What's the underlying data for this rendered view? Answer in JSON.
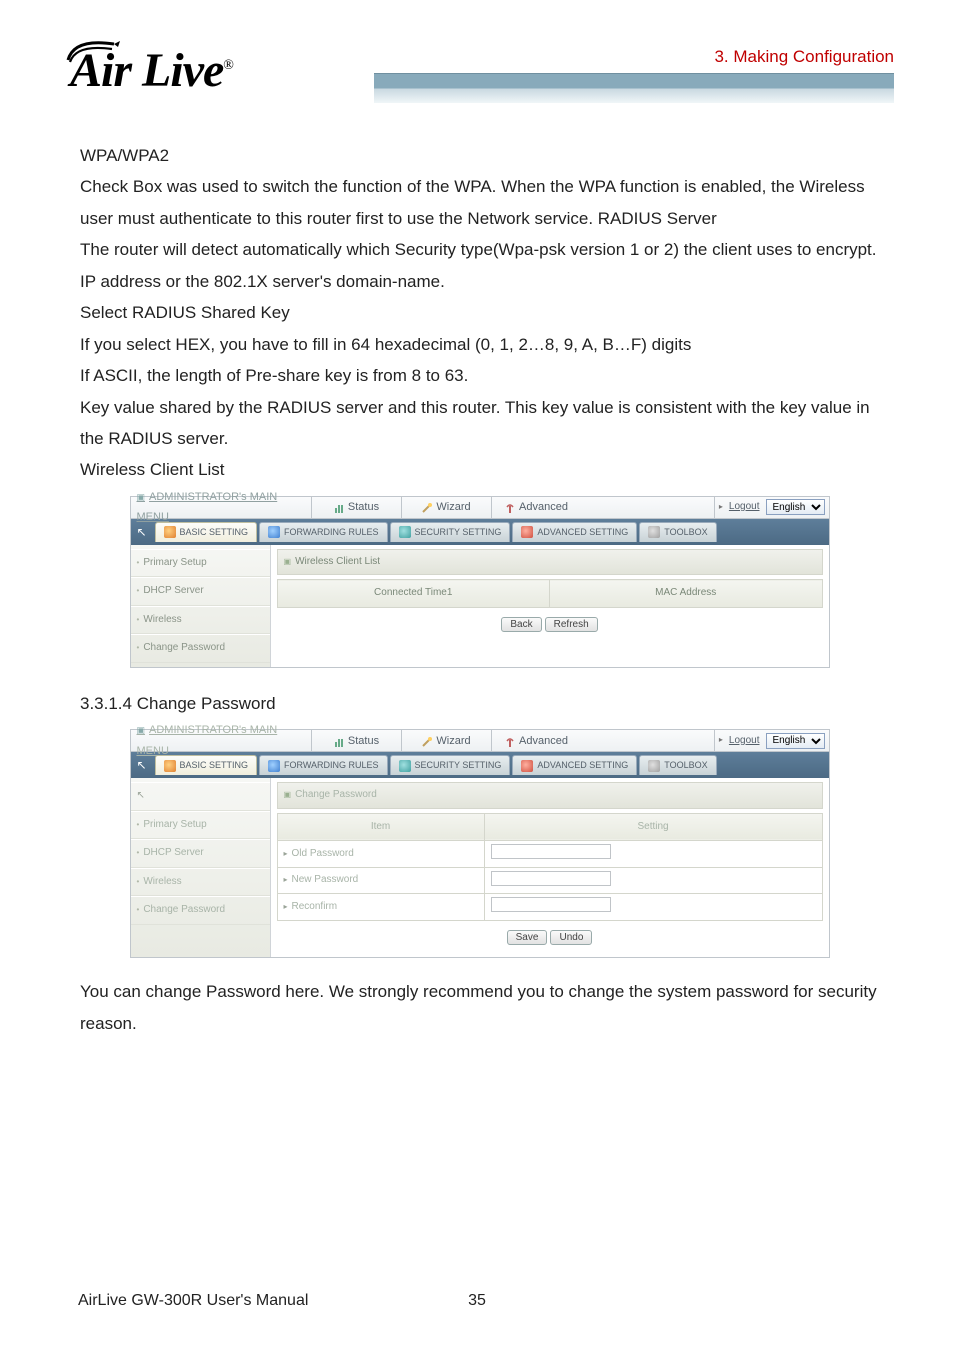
{
  "header": {
    "chapter": "3.  Making  Configuration",
    "logo_main": "Air Live",
    "logo_reg": "®"
  },
  "body": {
    "h1": "WPA/WPA2",
    "p1": "Check Box was used to switch the function of the WPA. When the WPA function is enabled, the Wireless user must authenticate to this router first to use the Network service. RADIUS Server",
    "p2": "The router will detect automatically    which Security type(Wpa-psk version 1 or 2) the client uses to encrypt.",
    "p3": "IP address or the 802.1X server's domain-name.",
    "p4": "Select RADIUS Shared Key",
    "p5": "If you select HEX, you have to fill in 64 hexadecimal (0, 1, 2…8, 9, A, B…F) digits",
    "p6": "If ASCII, the length of Pre-share key is from 8 to 63.",
    "p7": "Key value shared by the RADIUS server and this router. This key value is consistent with the key value in the RADIUS server.",
    "p8": "Wireless Client List",
    "sec314": "3.3.1.4 Change Password",
    "closing": "You can change Password here. We strongly recommend you to change the system password for security reason."
  },
  "panel_common": {
    "main_menu": "ADMINISTRATOR's MAIN MENU",
    "tab_status": "Status",
    "tab_wizard": "Wizard",
    "tab_advanced": "Advanced",
    "logout": "Logout",
    "lang": "English",
    "sub_basic": "BASIC SETTING",
    "sub_forward": "FORWARDING RULES",
    "sub_security": "SECURITY SETTING",
    "sub_advanced": "ADVANCED SETTING",
    "sub_toolbox": "TOOLBOX",
    "side_primary": "Primary Setup",
    "side_dhcp": "DHCP Server",
    "side_wireless": "Wireless",
    "side_change": "Change Password"
  },
  "panel1": {
    "section_title": "Wireless Client List",
    "col1": "Connected Time1",
    "col2": "MAC Address",
    "btn_back": "Back",
    "btn_refresh": "Refresh"
  },
  "panel2": {
    "section_title": "Change Password",
    "col_item": "Item",
    "col_setting": "Setting",
    "row_old": "Old Password",
    "row_new": "New Password",
    "row_reconfirm": "Reconfirm",
    "btn_save": "Save",
    "btn_undo": "Undo"
  },
  "footer": {
    "manual": "AirLive GW-300R User's Manual",
    "page": "35"
  }
}
